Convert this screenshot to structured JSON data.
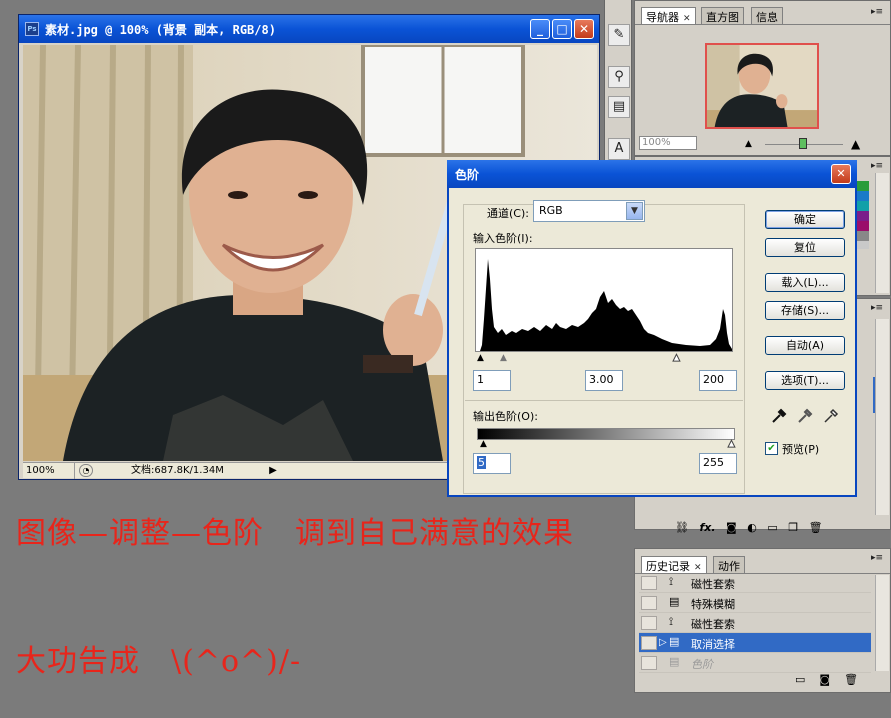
{
  "document": {
    "title": "素材.jpg @ 100% (背景 副本, RGB/8)",
    "app_badge": "Ps",
    "zoom": "100%",
    "doc_info": "文档:687.8K/1.34M"
  },
  "levels": {
    "title": "色阶",
    "channel_label": "通道(C):",
    "channel_value": "RGB",
    "input_label": "输入色阶(I):",
    "input_black": "1",
    "input_gamma": "3.00",
    "input_white": "200",
    "output_label": "输出色阶(O):",
    "output_black": "5",
    "output_white": "255",
    "buttons": {
      "ok": "确定",
      "reset": "复位",
      "load": "载入(L)...",
      "save": "存储(S)...",
      "auto": "自动(A)",
      "options": "选项(T)..."
    },
    "preview_label": "预览(P)",
    "preview_checked": true,
    "input_slider_levels": {
      "black": 1,
      "gamma": 3.0,
      "white": 200
    },
    "output_slider_levels": {
      "black": 5,
      "white": 255
    }
  },
  "navigator": {
    "tabs": [
      "导航器",
      "直方图",
      "信息"
    ],
    "zoom": "100%"
  },
  "history": {
    "tabs": [
      "历史记录",
      "动作"
    ],
    "items": [
      {
        "label": "磁性套索",
        "state": "normal"
      },
      {
        "label": "特殊模糊",
        "state": "normal"
      },
      {
        "label": "磁性套索",
        "state": "normal"
      },
      {
        "label": "取消选择",
        "state": "selected"
      },
      {
        "label": "色阶",
        "state": "undone"
      }
    ]
  },
  "layers_footer": "fx.",
  "captions": {
    "line1": "图像—调整—色阶　调到自己满意的效果",
    "line2": "大功告成　\\(^o^)/-"
  },
  "colors": {
    "title_bar": "#0a53d6",
    "caption": "#e8251b",
    "selection": "#316ac5",
    "nav_frame": "#e0504c"
  }
}
